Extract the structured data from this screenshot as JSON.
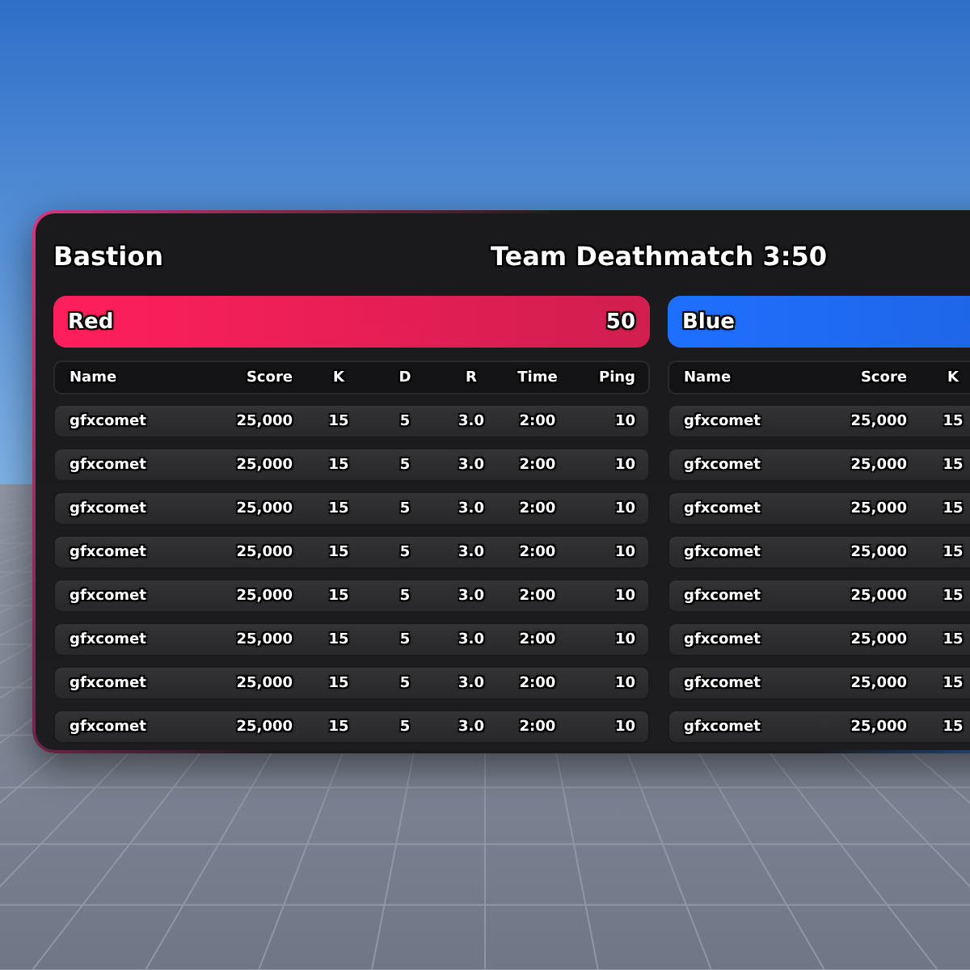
{
  "title": "Bastion",
  "mode": "Team Deathmatch 3:50",
  "teams": [
    {
      "name": "Red",
      "color": "#ff1f5c",
      "score": "50",
      "columns": [
        "Name",
        "Score",
        "K",
        "D",
        "R",
        "Time",
        "Ping"
      ],
      "rows": [
        [
          "gfxcomet",
          "25,000",
          "15",
          "5",
          "3.0",
          "2:00",
          "10"
        ],
        [
          "gfxcomet",
          "25,000",
          "15",
          "5",
          "3.0",
          "2:00",
          "10"
        ],
        [
          "gfxcomet",
          "25,000",
          "15",
          "5",
          "3.0",
          "2:00",
          "10"
        ],
        [
          "gfxcomet",
          "25,000",
          "15",
          "5",
          "3.0",
          "2:00",
          "10"
        ],
        [
          "gfxcomet",
          "25,000",
          "15",
          "5",
          "3.0",
          "2:00",
          "10"
        ],
        [
          "gfxcomet",
          "25,000",
          "15",
          "5",
          "3.0",
          "2:00",
          "10"
        ],
        [
          "gfxcomet",
          "25,000",
          "15",
          "5",
          "3.0",
          "2:00",
          "10"
        ],
        [
          "gfxcomet",
          "25,000",
          "15",
          "5",
          "3.0",
          "2:00",
          "10"
        ]
      ]
    },
    {
      "name": "Blue",
      "color": "#1f6fff",
      "columns": [
        "Name",
        "Score",
        "K"
      ],
      "rows": [
        [
          "gfxcomet",
          "25,000",
          "15"
        ],
        [
          "gfxcomet",
          "25,000",
          "15"
        ],
        [
          "gfxcomet",
          "25,000",
          "15"
        ],
        [
          "gfxcomet",
          "25,000",
          "15"
        ],
        [
          "gfxcomet",
          "25,000",
          "15"
        ],
        [
          "gfxcomet",
          "25,000",
          "15"
        ],
        [
          "gfxcomet",
          "25,000",
          "15"
        ],
        [
          "gfxcomet",
          "25,000",
          "15"
        ]
      ]
    }
  ]
}
